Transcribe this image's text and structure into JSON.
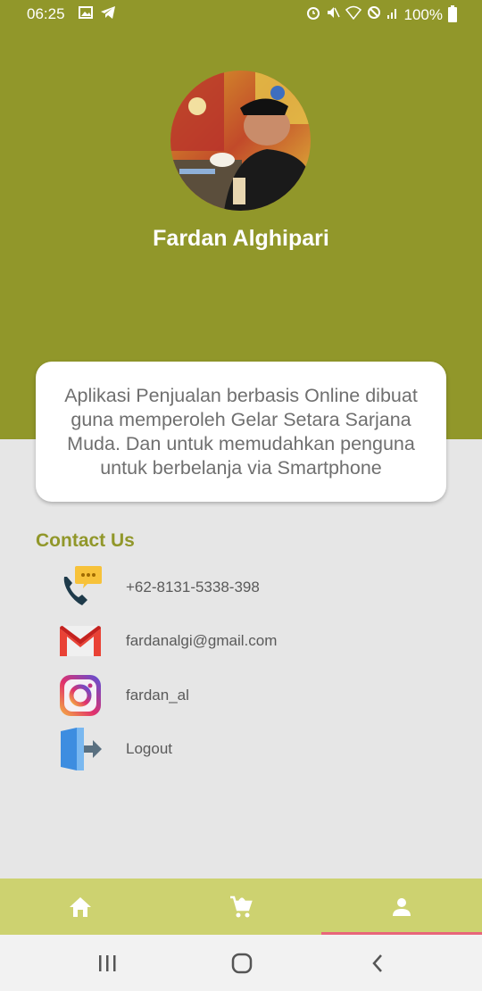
{
  "status_bar": {
    "time": "06:25",
    "battery_pct": "100%",
    "left_icons": [
      "image-icon",
      "telegram-icon"
    ],
    "right_icons": [
      "alarm-icon",
      "mute-icon",
      "wifi-icon",
      "dnd-icon",
      "signal-icon",
      "battery-icon"
    ]
  },
  "profile": {
    "name": "Fardan Alghipari",
    "avatar": "profile-photo"
  },
  "about": {
    "text": "Aplikasi Penjualan berbasis Online dibuat guna memperoleh Gelar Setara Sarjana Muda. Dan untuk memudahkan penguna untuk berbelanja via Smartphone"
  },
  "contact": {
    "title": "Contact Us",
    "items": [
      {
        "icon": "phone-chat-icon",
        "label": "+62-8131-5338-398"
      },
      {
        "icon": "gmail-icon",
        "label": "fardanalgi@gmail.com"
      },
      {
        "icon": "instagram-icon",
        "label": "fardan_al"
      },
      {
        "icon": "logout-icon",
        "label": "Logout"
      }
    ]
  },
  "bottom_nav": {
    "items": [
      {
        "icon": "home-icon",
        "active": false
      },
      {
        "icon": "cart-icon",
        "active": false
      },
      {
        "icon": "person-icon",
        "active": true
      }
    ],
    "active_indicator_color": "#e8667a"
  },
  "android_nav": [
    "recents-icon",
    "home-circle-icon",
    "back-icon"
  ],
  "colors": {
    "header": "#91972a",
    "nav_bar": "#cdd270",
    "background": "#e6e6e6",
    "accent_text": "#91972a"
  }
}
